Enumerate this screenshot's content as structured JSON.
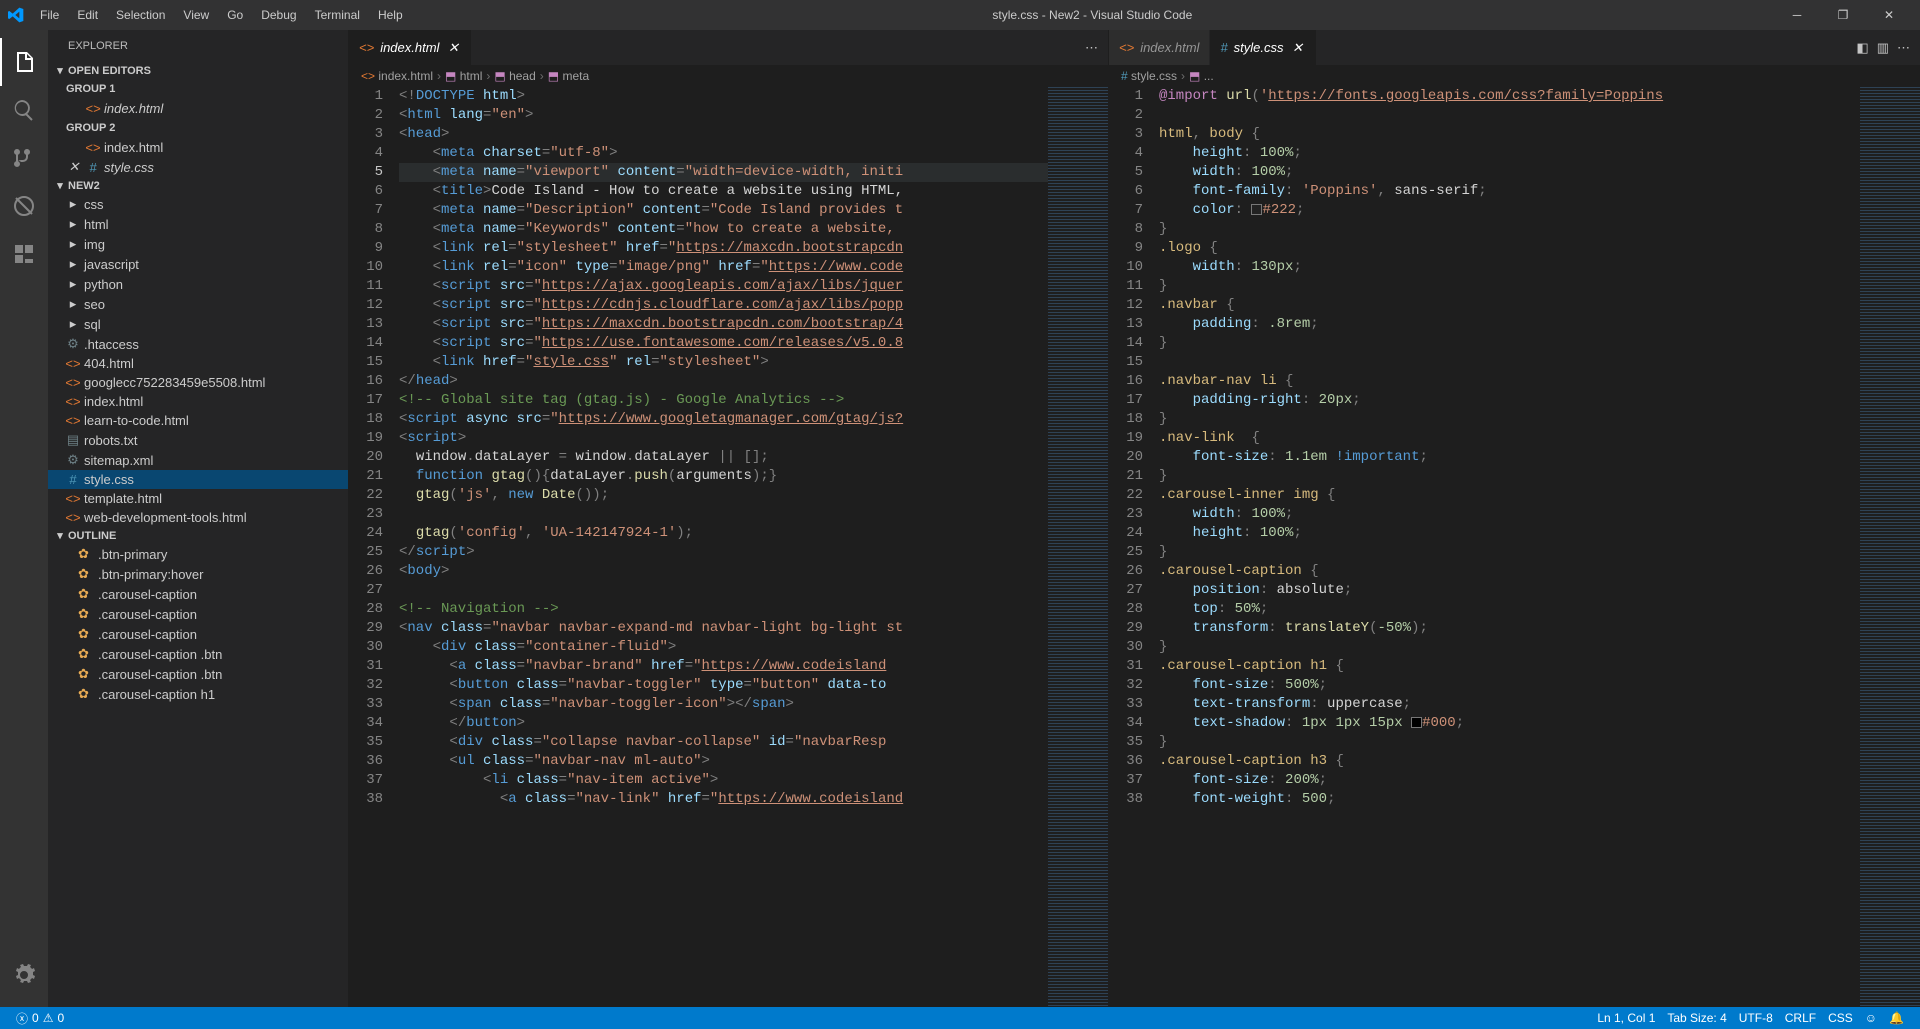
{
  "title": "style.css - New2 - Visual Studio Code",
  "menus": [
    "File",
    "Edit",
    "Selection",
    "View",
    "Go",
    "Debug",
    "Terminal",
    "Help"
  ],
  "sidebar": {
    "title": "Explorer",
    "openEditors": {
      "label": "Open Editors"
    },
    "groups": [
      {
        "label": "Group 1",
        "files": [
          {
            "name": "index.html",
            "icon": "html",
            "italic": true
          }
        ]
      },
      {
        "label": "Group 2",
        "files": [
          {
            "name": "index.html",
            "icon": "html"
          },
          {
            "name": "style.css",
            "icon": "css",
            "italic": true,
            "close": true
          }
        ]
      }
    ],
    "workspace": {
      "label": "New2"
    },
    "tree": [
      {
        "name": "css",
        "type": "folder",
        "depth": 1
      },
      {
        "name": "html",
        "type": "folder",
        "depth": 1
      },
      {
        "name": "img",
        "type": "folder",
        "depth": 1
      },
      {
        "name": "javascript",
        "type": "folder",
        "depth": 1
      },
      {
        "name": "python",
        "type": "folder",
        "depth": 1
      },
      {
        "name": "seo",
        "type": "folder",
        "depth": 1
      },
      {
        "name": "sql",
        "type": "folder",
        "depth": 1
      },
      {
        "name": ".htaccess",
        "type": "file",
        "icon": "gear",
        "depth": 1
      },
      {
        "name": "404.html",
        "type": "file",
        "icon": "html",
        "depth": 1
      },
      {
        "name": "googlecc752283459e5508.html",
        "type": "file",
        "icon": "html",
        "depth": 1
      },
      {
        "name": "index.html",
        "type": "file",
        "icon": "html",
        "depth": 1
      },
      {
        "name": "learn-to-code.html",
        "type": "file",
        "icon": "html",
        "depth": 1
      },
      {
        "name": "robots.txt",
        "type": "file",
        "icon": "txt",
        "depth": 1
      },
      {
        "name": "sitemap.xml",
        "type": "file",
        "icon": "xml",
        "depth": 1
      },
      {
        "name": "style.css",
        "type": "file",
        "icon": "css",
        "depth": 1,
        "active": true
      },
      {
        "name": "template.html",
        "type": "file",
        "icon": "html",
        "depth": 1
      },
      {
        "name": "web-development-tools.html",
        "type": "file",
        "icon": "html",
        "depth": 1
      }
    ],
    "outline": {
      "label": "Outline",
      "items": [
        ".btn-primary",
        ".btn-primary:hover",
        ".carousel-caption",
        ".carousel-caption",
        ".carousel-caption",
        ".carousel-caption .btn",
        ".carousel-caption .btn",
        ".carousel-caption h1"
      ]
    }
  },
  "editorLeft": {
    "tab": {
      "name": "index.html",
      "icon": "html"
    },
    "breadcrumbs": [
      "index.html",
      "html",
      "head",
      "meta"
    ],
    "currentLine": 5,
    "lines": [
      {
        "n": 1,
        "html": "<span class='tk-punc'>&lt;!</span><span class='tk-tag'>DOCTYPE</span> <span class='tk-attr'>html</span><span class='tk-punc'>&gt;</span>"
      },
      {
        "n": 2,
        "html": "<span class='tk-punc'>&lt;</span><span class='tk-tag'>html</span> <span class='tk-attr'>lang</span><span class='tk-punc'>=</span><span class='tk-str'>\"en\"</span><span class='tk-punc'>&gt;</span>"
      },
      {
        "n": 3,
        "html": "<span class='tk-punc'>&lt;</span><span class='tk-tag'>head</span><span class='tk-punc'>&gt;</span>"
      },
      {
        "n": 4,
        "html": "    <span class='tk-punc'>&lt;</span><span class='tk-tag'>meta</span> <span class='tk-attr'>charset</span><span class='tk-punc'>=</span><span class='tk-str'>\"utf-8\"</span><span class='tk-punc'>&gt;</span>"
      },
      {
        "n": 5,
        "html": "    <span class='tk-punc'>&lt;</span><span class='tk-tag'>meta</span> <span class='tk-attr'>name</span><span class='tk-punc'>=</span><span class='tk-str'>\"viewport\"</span> <span class='tk-attr'>content</span><span class='tk-punc'>=</span><span class='tk-str'>\"width=device-width, initi</span>"
      },
      {
        "n": 6,
        "html": "    <span class='tk-punc'>&lt;</span><span class='tk-tag'>title</span><span class='tk-punc'>&gt;</span><span class='tk-text'>Code Island - How to create a website using HTML,</span>"
      },
      {
        "n": 7,
        "html": "    <span class='tk-punc'>&lt;</span><span class='tk-tag'>meta</span> <span class='tk-attr'>name</span><span class='tk-punc'>=</span><span class='tk-str'>\"Description\"</span> <span class='tk-attr'>content</span><span class='tk-punc'>=</span><span class='tk-str'>\"Code Island provides t</span>"
      },
      {
        "n": 8,
        "html": "    <span class='tk-punc'>&lt;</span><span class='tk-tag'>meta</span> <span class='tk-attr'>name</span><span class='tk-punc'>=</span><span class='tk-str'>\"Keywords\"</span> <span class='tk-attr'>content</span><span class='tk-punc'>=</span><span class='tk-str'>\"how to create a website, </span>"
      },
      {
        "n": 9,
        "html": "    <span class='tk-punc'>&lt;</span><span class='tk-tag'>link</span> <span class='tk-attr'>rel</span><span class='tk-punc'>=</span><span class='tk-str'>\"stylesheet\"</span> <span class='tk-attr'>href</span><span class='tk-punc'>=</span><span class='tk-str'>\"</span><span class='tk-url'>https://maxcdn.bootstrapcdn</span>"
      },
      {
        "n": 10,
        "html": "    <span class='tk-punc'>&lt;</span><span class='tk-tag'>link</span> <span class='tk-attr'>rel</span><span class='tk-punc'>=</span><span class='tk-str'>\"icon\"</span> <span class='tk-attr'>type</span><span class='tk-punc'>=</span><span class='tk-str'>\"image/png\"</span> <span class='tk-attr'>href</span><span class='tk-punc'>=</span><span class='tk-str'>\"</span><span class='tk-url'>https://www.code</span>"
      },
      {
        "n": 11,
        "html": "    <span class='tk-punc'>&lt;</span><span class='tk-tag'>script</span> <span class='tk-attr'>src</span><span class='tk-punc'>=</span><span class='tk-str'>\"</span><span class='tk-url'>https://ajax.googleapis.com/ajax/libs/jquer</span>"
      },
      {
        "n": 12,
        "html": "    <span class='tk-punc'>&lt;</span><span class='tk-tag'>script</span> <span class='tk-attr'>src</span><span class='tk-punc'>=</span><span class='tk-str'>\"</span><span class='tk-url'>https://cdnjs.cloudflare.com/ajax/libs/popp</span>"
      },
      {
        "n": 13,
        "html": "    <span class='tk-punc'>&lt;</span><span class='tk-tag'>script</span> <span class='tk-attr'>src</span><span class='tk-punc'>=</span><span class='tk-str'>\"</span><span class='tk-url'>https://maxcdn.bootstrapcdn.com/bootstrap/4</span>"
      },
      {
        "n": 14,
        "html": "    <span class='tk-punc'>&lt;</span><span class='tk-tag'>script</span> <span class='tk-attr'>src</span><span class='tk-punc'>=</span><span class='tk-str'>\"</span><span class='tk-url'>https://use.fontawesome.com/releases/v5.0.8</span>"
      },
      {
        "n": 15,
        "html": "    <span class='tk-punc'>&lt;</span><span class='tk-tag'>link</span> <span class='tk-attr'>href</span><span class='tk-punc'>=</span><span class='tk-str'>\"</span><span class='tk-url'>style.css</span><span class='tk-str'>\"</span> <span class='tk-attr'>rel</span><span class='tk-punc'>=</span><span class='tk-str'>\"stylesheet\"</span><span class='tk-punc'>&gt;</span>"
      },
      {
        "n": 16,
        "html": "<span class='tk-punc'>&lt;/</span><span class='tk-tag'>head</span><span class='tk-punc'>&gt;</span>"
      },
      {
        "n": 17,
        "html": "<span class='tk-comment'>&lt;!-- Global site tag (gtag.js) - Google Analytics --&gt;</span>"
      },
      {
        "n": 18,
        "html": "<span class='tk-punc'>&lt;</span><span class='tk-tag'>script</span> <span class='tk-attr'>async src</span><span class='tk-punc'>=</span><span class='tk-str'>\"</span><span class='tk-url'>https://www.googletagmanager.com/gtag/js?</span>"
      },
      {
        "n": 19,
        "html": "<span class='tk-punc'>&lt;</span><span class='tk-tag'>script</span><span class='tk-punc'>&gt;</span>"
      },
      {
        "n": 20,
        "html": "  <span class='tk-text'>window</span><span class='tk-punc'>.</span><span class='tk-text'>dataLayer</span> <span class='tk-punc'>=</span> <span class='tk-text'>window</span><span class='tk-punc'>.</span><span class='tk-text'>dataLayer</span> <span class='tk-punc'>|| [];</span>"
      },
      {
        "n": 21,
        "html": "  <span class='tk-kw'>function</span> <span class='tk-fn'>gtag</span><span class='tk-punc'>(){</span><span class='tk-text'>dataLayer</span><span class='tk-punc'>.</span><span class='tk-fn'>push</span><span class='tk-punc'>(</span><span class='tk-text'>arguments</span><span class='tk-punc'>);}</span>"
      },
      {
        "n": 22,
        "html": "  <span class='tk-fn'>gtag</span><span class='tk-punc'>(</span><span class='tk-str'>'js'</span><span class='tk-punc'>,</span> <span class='tk-kw'>new</span> <span class='tk-fn'>Date</span><span class='tk-punc'>());</span>"
      },
      {
        "n": 23,
        "html": ""
      },
      {
        "n": 24,
        "html": "  <span class='tk-fn'>gtag</span><span class='tk-punc'>(</span><span class='tk-str'>'config'</span><span class='tk-punc'>,</span> <span class='tk-str'>'UA-142147924-1'</span><span class='tk-punc'>);</span>"
      },
      {
        "n": 25,
        "html": "<span class='tk-punc'>&lt;/</span><span class='tk-tag'>script</span><span class='tk-punc'>&gt;</span>"
      },
      {
        "n": 26,
        "html": "<span class='tk-punc'>&lt;</span><span class='tk-tag'>body</span><span class='tk-punc'>&gt;</span>"
      },
      {
        "n": 27,
        "html": ""
      },
      {
        "n": 28,
        "html": "<span class='tk-comment'>&lt;!-- Navigation --&gt;</span>"
      },
      {
        "n": 29,
        "html": "<span class='tk-punc'>&lt;</span><span class='tk-tag'>nav</span> <span class='tk-attr'>class</span><span class='tk-punc'>=</span><span class='tk-str'>\"navbar navbar-expand-md navbar-light bg-light st</span>"
      },
      {
        "n": 30,
        "html": "    <span class='tk-punc'>&lt;</span><span class='tk-tag'>div</span> <span class='tk-attr'>class</span><span class='tk-punc'>=</span><span class='tk-str'>\"container-fluid\"</span><span class='tk-punc'>&gt;</span>"
      },
      {
        "n": 31,
        "html": "      <span class='tk-punc'>&lt;</span><span class='tk-tag'>a</span> <span class='tk-attr'>class</span><span class='tk-punc'>=</span><span class='tk-str'>\"navbar-brand\"</span> <span class='tk-attr'>href</span><span class='tk-punc'>=</span><span class='tk-str'>\"</span><span class='tk-url'>https://www.codeisland</span>"
      },
      {
        "n": 32,
        "html": "      <span class='tk-punc'>&lt;</span><span class='tk-tag'>button</span> <span class='tk-attr'>class</span><span class='tk-punc'>=</span><span class='tk-str'>\"navbar-toggler\"</span> <span class='tk-attr'>type</span><span class='tk-punc'>=</span><span class='tk-str'>\"button\"</span> <span class='tk-attr'>data-to</span>"
      },
      {
        "n": 33,
        "html": "      <span class='tk-punc'>&lt;</span><span class='tk-tag'>span</span> <span class='tk-attr'>class</span><span class='tk-punc'>=</span><span class='tk-str'>\"navbar-toggler-icon\"</span><span class='tk-punc'>&gt;&lt;/</span><span class='tk-tag'>span</span><span class='tk-punc'>&gt;</span>"
      },
      {
        "n": 34,
        "html": "      <span class='tk-punc'>&lt;/</span><span class='tk-tag'>button</span><span class='tk-punc'>&gt;</span>"
      },
      {
        "n": 35,
        "html": "      <span class='tk-punc'>&lt;</span><span class='tk-tag'>div</span> <span class='tk-attr'>class</span><span class='tk-punc'>=</span><span class='tk-str'>\"collapse navbar-collapse\"</span> <span class='tk-attr'>id</span><span class='tk-punc'>=</span><span class='tk-str'>\"navbarResp</span>"
      },
      {
        "n": 36,
        "html": "      <span class='tk-punc'>&lt;</span><span class='tk-tag'>ul</span> <span class='tk-attr'>class</span><span class='tk-punc'>=</span><span class='tk-str'>\"navbar-nav ml-auto\"</span><span class='tk-punc'>&gt;</span>"
      },
      {
        "n": 37,
        "html": "          <span class='tk-punc'>&lt;</span><span class='tk-tag'>li</span> <span class='tk-attr'>class</span><span class='tk-punc'>=</span><span class='tk-str'>\"nav-item active\"</span><span class='tk-punc'>&gt;</span>"
      },
      {
        "n": 38,
        "html": "            <span class='tk-punc'>&lt;</span><span class='tk-tag'>a</span> <span class='tk-attr'>class</span><span class='tk-punc'>=</span><span class='tk-str'>\"nav-link\"</span> <span class='tk-attr'>href</span><span class='tk-punc'>=</span><span class='tk-str'>\"</span><span class='tk-url'>https://www.codeisland</span>"
      }
    ]
  },
  "editorRight": {
    "tabs": [
      {
        "name": "index.html",
        "icon": "html"
      },
      {
        "name": "style.css",
        "icon": "css",
        "active": true
      }
    ],
    "breadcrumbs": [
      "style.css",
      "..."
    ],
    "lines": [
      {
        "n": 1,
        "html": "<span class='tk-imp'>@import</span> <span class='tk-fn'>url</span><span class='tk-punc'>(</span><span class='tk-str'>'</span><span class='tk-url'>https://fonts.googleapis.com/css?family=Poppins</span>"
      },
      {
        "n": 2,
        "html": ""
      },
      {
        "n": 3,
        "html": "<span class='tk-sel'>html</span><span class='tk-punc'>,</span> <span class='tk-sel'>body</span> <span class='tk-punc'>{</span>"
      },
      {
        "n": 4,
        "html": "    <span class='tk-prop'>height</span><span class='tk-punc'>:</span> <span class='tk-num'>100%</span><span class='tk-punc'>;</span>"
      },
      {
        "n": 5,
        "html": "    <span class='tk-prop'>width</span><span class='tk-punc'>:</span> <span class='tk-num'>100%</span><span class='tk-punc'>;</span>"
      },
      {
        "n": 6,
        "html": "    <span class='tk-prop'>font-family</span><span class='tk-punc'>:</span> <span class='tk-str'>'Poppins'</span><span class='tk-punc'>,</span> <span class='tk-text'>sans-serif</span><span class='tk-punc'>;</span>"
      },
      {
        "n": 7,
        "html": "    <span class='tk-prop'>color</span><span class='tk-punc'>:</span> <span style='display:inline-block;width:11px;height:11px;background:#222;border:1px solid #777;vertical-align:middle'></span><span class='tk-str'>#222</span><span class='tk-punc'>;</span>"
      },
      {
        "n": 8,
        "html": "<span class='tk-punc'>}</span>"
      },
      {
        "n": 9,
        "html": "<span class='tk-sel'>.logo</span> <span class='tk-punc'>{</span>"
      },
      {
        "n": 10,
        "html": "    <span class='tk-prop'>width</span><span class='tk-punc'>:</span> <span class='tk-num'>130px</span><span class='tk-punc'>;</span>"
      },
      {
        "n": 11,
        "html": "<span class='tk-punc'>}</span>"
      },
      {
        "n": 12,
        "html": "<span class='tk-sel'>.navbar</span> <span class='tk-punc'>{</span>"
      },
      {
        "n": 13,
        "html": "    <span class='tk-prop'>padding</span><span class='tk-punc'>:</span> <span class='tk-num'>.8rem</span><span class='tk-punc'>;</span>"
      },
      {
        "n": 14,
        "html": "<span class='tk-punc'>}</span>"
      },
      {
        "n": 15,
        "html": ""
      },
      {
        "n": 16,
        "html": "<span class='tk-sel'>.navbar-nav li</span> <span class='tk-punc'>{</span>"
      },
      {
        "n": 17,
        "html": "    <span class='tk-prop'>padding-right</span><span class='tk-punc'>:</span> <span class='tk-num'>20px</span><span class='tk-punc'>;</span>"
      },
      {
        "n": 18,
        "html": "<span class='tk-punc'>}</span>"
      },
      {
        "n": 19,
        "html": "<span class='tk-sel'>.nav-link</span>  <span class='tk-punc'>{</span>"
      },
      {
        "n": 20,
        "html": "    <span class='tk-prop'>font-size</span><span class='tk-punc'>:</span> <span class='tk-num'>1.1em</span> <span class='tk-kw'>!important</span><span class='tk-punc'>;</span>"
      },
      {
        "n": 21,
        "html": "<span class='tk-punc'>}</span>"
      },
      {
        "n": 22,
        "html": "<span class='tk-sel'>.carousel-inner img</span> <span class='tk-punc'>{</span>"
      },
      {
        "n": 23,
        "html": "    <span class='tk-prop'>width</span><span class='tk-punc'>:</span> <span class='tk-num'>100%</span><span class='tk-punc'>;</span>"
      },
      {
        "n": 24,
        "html": "    <span class='tk-prop'>height</span><span class='tk-punc'>:</span> <span class='tk-num'>100%</span><span class='tk-punc'>;</span>"
      },
      {
        "n": 25,
        "html": "<span class='tk-punc'>}</span>"
      },
      {
        "n": 26,
        "html": "<span class='tk-sel'>.carousel-caption</span> <span class='tk-punc'>{</span>"
      },
      {
        "n": 27,
        "html": "    <span class='tk-prop'>position</span><span class='tk-punc'>:</span> <span class='tk-text'>absolute</span><span class='tk-punc'>;</span>"
      },
      {
        "n": 28,
        "html": "    <span class='tk-prop'>top</span><span class='tk-punc'>:</span> <span class='tk-num'>50%</span><span class='tk-punc'>;</span>"
      },
      {
        "n": 29,
        "html": "    <span class='tk-prop'>transform</span><span class='tk-punc'>:</span> <span class='tk-fn'>translateY</span><span class='tk-punc'>(</span><span class='tk-num'>-50%</span><span class='tk-punc'>);</span>"
      },
      {
        "n": 30,
        "html": "<span class='tk-punc'>}</span>"
      },
      {
        "n": 31,
        "html": "<span class='tk-sel'>.carousel-caption h1</span> <span class='tk-punc'>{</span>"
      },
      {
        "n": 32,
        "html": "    <span class='tk-prop'>font-size</span><span class='tk-punc'>:</span> <span class='tk-num'>500%</span><span class='tk-punc'>;</span>"
      },
      {
        "n": 33,
        "html": "    <span class='tk-prop'>text-transform</span><span class='tk-punc'>:</span> <span class='tk-text'>uppercase</span><span class='tk-punc'>;</span>"
      },
      {
        "n": 34,
        "html": "    <span class='tk-prop'>text-shadow</span><span class='tk-punc'>:</span> <span class='tk-num'>1px 1px 15px</span> <span style='display:inline-block;width:11px;height:11px;background:#000;border:1px solid #777;vertical-align:middle'></span><span class='tk-str'>#000</span><span class='tk-punc'>;</span>"
      },
      {
        "n": 35,
        "html": "<span class='tk-punc'>}</span>"
      },
      {
        "n": 36,
        "html": "<span class='tk-sel'>.carousel-caption h3</span> <span class='tk-punc'>{</span>"
      },
      {
        "n": 37,
        "html": "    <span class='tk-prop'>font-size</span><span class='tk-punc'>:</span> <span class='tk-num'>200%</span><span class='tk-punc'>;</span>"
      },
      {
        "n": 38,
        "html": "    <span class='tk-prop'>font-weight</span><span class='tk-punc'>:</span> <span class='tk-num'>500</span><span class='tk-punc'>;</span>"
      }
    ]
  },
  "statusbar": {
    "errors": "0",
    "warnings": "0",
    "lncol": "Ln 1, Col 1",
    "tabsize": "Tab Size: 4",
    "encoding": "UTF-8",
    "eol": "CRLF",
    "lang": "CSS"
  },
  "icons": {
    "html": "#e37933",
    "css": "#519aba",
    "txt": "#6d8086",
    "xml": "#6d8086",
    "gear": "#6d8086"
  }
}
